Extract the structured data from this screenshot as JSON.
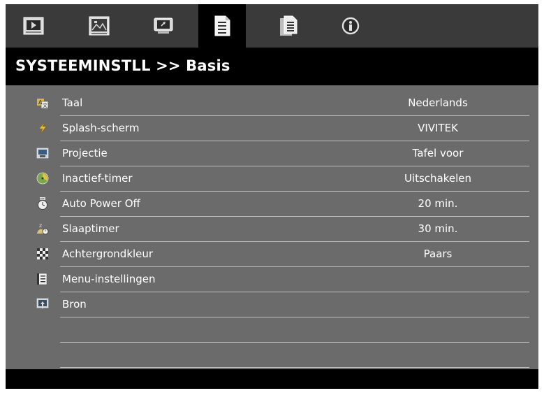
{
  "tabs": [
    {
      "icon": "picture-icon"
    },
    {
      "icon": "image-adjust-icon"
    },
    {
      "icon": "display-icon"
    },
    {
      "icon": "system-settings-basic-icon",
      "active": true
    },
    {
      "icon": "system-settings-advanced-icon"
    },
    {
      "icon": "information-icon"
    }
  ],
  "header": {
    "title": "SYSTEEMINSTLL >> Basis"
  },
  "menu": {
    "items": [
      {
        "label": "Taal",
        "value": "Nederlands",
        "icon": "language-icon"
      },
      {
        "label": "Splash-scherm",
        "value": "VIVITEK",
        "icon": "lightning-icon"
      },
      {
        "label": "Projectie",
        "value": "Tafel voor",
        "icon": "projection-icon"
      },
      {
        "label": "Inactief-timer",
        "value": "Uitschakelen",
        "icon": "inactive-timer-icon"
      },
      {
        "label": "Auto Power Off",
        "value": "20 min.",
        "icon": "auto-power-off-icon"
      },
      {
        "label": "Slaaptimer",
        "value": "30 min.",
        "icon": "sleep-timer-icon"
      },
      {
        "label": "Achtergrondkleur",
        "value": "Paars",
        "icon": "background-color-icon"
      },
      {
        "label": "Menu-instellingen",
        "value": "",
        "icon": "menu-settings-icon"
      },
      {
        "label": "Bron",
        "value": "",
        "icon": "source-icon"
      },
      {
        "label": "",
        "value": ""
      },
      {
        "label": "",
        "value": ""
      }
    ]
  },
  "colors": {
    "tab_bar": "#3a3a3a",
    "active_tab": "#000000",
    "content_bg": "#6b6b6b",
    "title_bg": "#000000",
    "text": "#ffffff",
    "divider": "#bdbdbd"
  }
}
